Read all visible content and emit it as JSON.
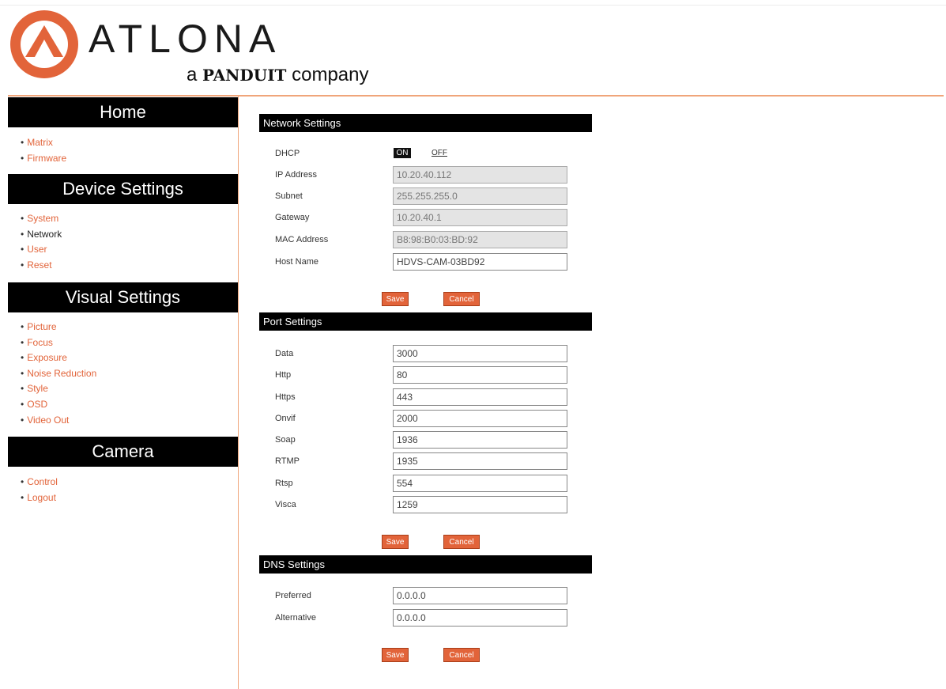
{
  "brand": {
    "name": "ATLONA",
    "tagline_prefix": "a",
    "tagline_brand": "PANDUIT",
    "tagline_suffix": "company",
    "accent_color": "#e2643a"
  },
  "sidebar": {
    "sections": [
      {
        "title": "Home",
        "items": [
          "Matrix",
          "Firmware"
        ]
      },
      {
        "title": "Device Settings",
        "items": [
          "System",
          "Network",
          "User",
          "Reset"
        ]
      },
      {
        "title": "Visual Settings",
        "items": [
          "Picture",
          "Focus",
          "Exposure",
          "Noise Reduction",
          "Style",
          "OSD",
          "Video Out"
        ]
      },
      {
        "title": "Camera",
        "items": [
          "Control",
          "Logout"
        ]
      }
    ],
    "active_item": "Network"
  },
  "network": {
    "title": "Network Settings",
    "dhcp_label": "DHCP",
    "dhcp_on": "ON",
    "dhcp_off": "OFF",
    "fields": [
      {
        "label": "IP Address",
        "value": "10.20.40.112",
        "readonly": true
      },
      {
        "label": "Subnet",
        "value": "255.255.255.0",
        "readonly": true
      },
      {
        "label": "Gateway",
        "value": "10.20.40.1",
        "readonly": true
      },
      {
        "label": "MAC Address",
        "value": "B8:98:B0:03:BD:92",
        "readonly": true
      },
      {
        "label": "Host Name",
        "value": "HDVS-CAM-03BD92",
        "readonly": false
      }
    ],
    "save": "Save",
    "cancel": "Cancel"
  },
  "ports": {
    "title": "Port Settings",
    "fields": [
      {
        "label": "Data",
        "value": "3000"
      },
      {
        "label": "Http",
        "value": "80"
      },
      {
        "label": "Https",
        "value": "443"
      },
      {
        "label": "Onvif",
        "value": "2000"
      },
      {
        "label": "Soap",
        "value": "1936"
      },
      {
        "label": "RTMP",
        "value": "1935"
      },
      {
        "label": "Rtsp",
        "value": "554"
      },
      {
        "label": "Visca",
        "value": "1259"
      }
    ],
    "save": "Save",
    "cancel": "Cancel"
  },
  "dns": {
    "title": "DNS Settings",
    "fields": [
      {
        "label": "Preferred",
        "value": "0.0.0.0"
      },
      {
        "label": "Alternative",
        "value": "0.0.0.0"
      }
    ],
    "save": "Save",
    "cancel": "Cancel"
  }
}
